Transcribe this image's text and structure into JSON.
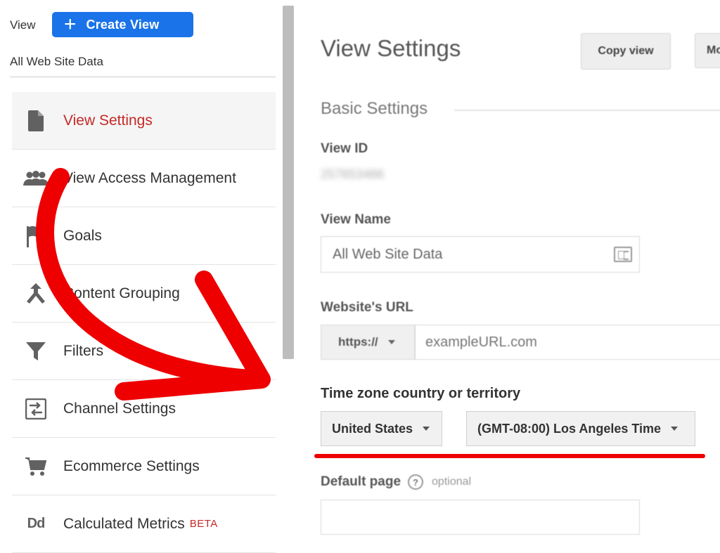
{
  "sidebar": {
    "view_label": "View",
    "create_button_label": "Create View",
    "view_name": "All Web Site Data",
    "items": [
      {
        "label": "View Settings",
        "icon": "document-icon",
        "active": true
      },
      {
        "label": "View Access Management",
        "icon": "people-icon"
      },
      {
        "label": "Goals",
        "icon": "flag-icon"
      },
      {
        "label": "Content Grouping",
        "icon": "merge-icon"
      },
      {
        "label": "Filters",
        "icon": "filter-icon"
      },
      {
        "label": "Channel Settings",
        "icon": "channel-icon"
      },
      {
        "label": "Ecommerce Settings",
        "icon": "cart-icon"
      },
      {
        "label": "Calculated Metrics",
        "icon": "dd-icon",
        "icon_text": "Dd",
        "badge": "BETA"
      }
    ]
  },
  "main": {
    "title": "View Settings",
    "copy_button": "Copy view",
    "move_button": "Move",
    "section_title": "Basic Settings",
    "view_id_label": "View ID",
    "view_id_value": "257653466",
    "view_name_label": "View Name",
    "view_name_value": "All Web Site Data",
    "website_url_label": "Website's URL",
    "protocol": "https://",
    "url_placeholder": "exampleURL.com",
    "timezone_label": "Time zone country or territory",
    "country": "United States",
    "timezone": "(GMT-08:00) Los Angeles Time",
    "default_page_label": "Default page",
    "help_glyph": "?",
    "optional_label": "optional"
  },
  "colors": {
    "accent_blue": "#1a73e8",
    "active_red": "#c62828",
    "annotation_red": "#ee0000"
  }
}
